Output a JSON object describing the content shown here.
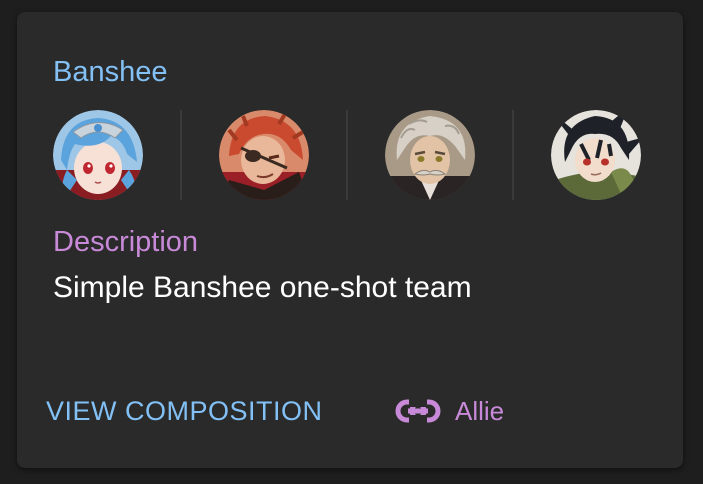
{
  "card": {
    "title": "Banshee",
    "portraits": [
      {
        "icon": "hero-portrait-blue-hair"
      },
      {
        "icon": "hero-portrait-red-hair-eyepatch"
      },
      {
        "icon": "hero-portrait-grey-hair-mustache"
      },
      {
        "icon": "hero-portrait-black-hair-green-scarf"
      }
    ],
    "description_label": "Description",
    "description": "Simple Banshee one-shot team",
    "view_button": "VIEW COMPOSITION",
    "author_icon": "link-icon",
    "author": "Allie"
  },
  "colors": {
    "background": "#1e1e1e",
    "card": "#2a2a2a",
    "title": "#82c0f5",
    "label": "#c88ad8",
    "text": "#ffffff"
  }
}
